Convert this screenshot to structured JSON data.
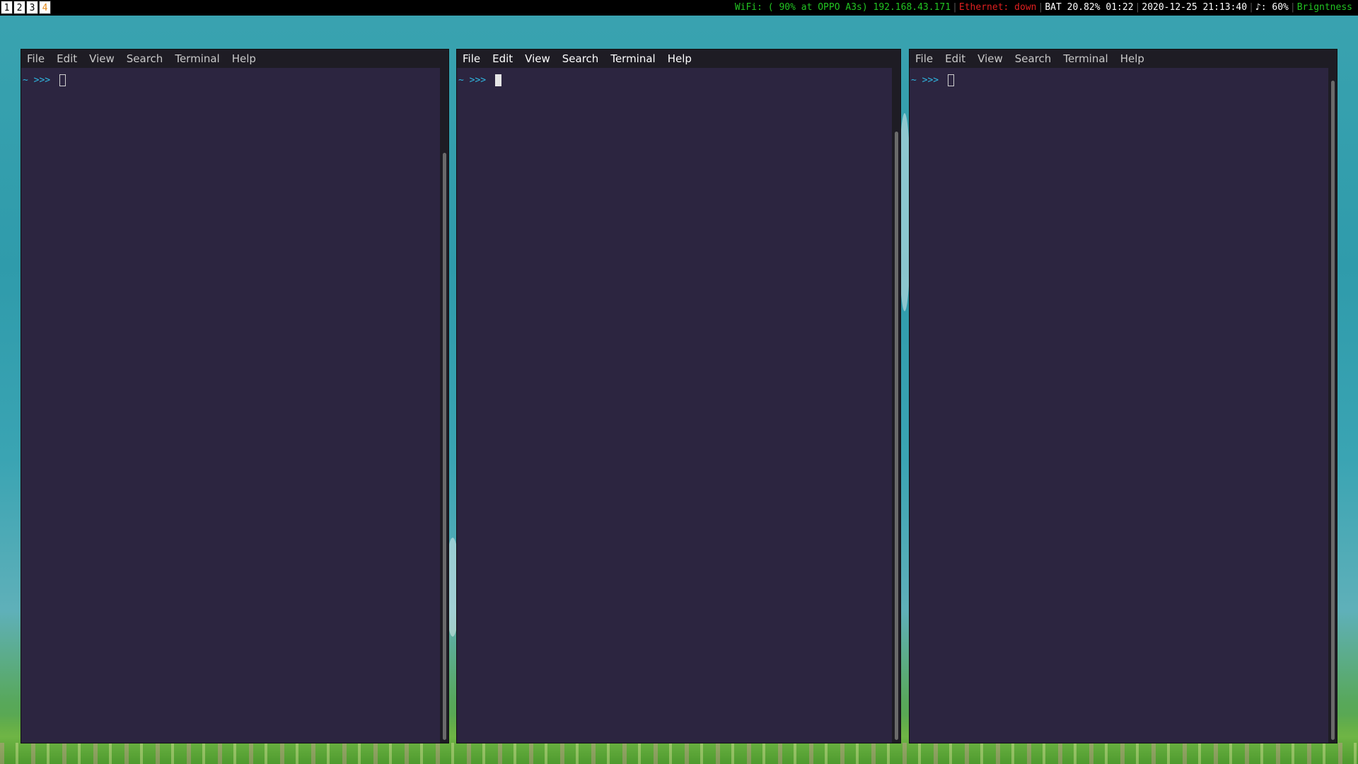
{
  "workspaces": [
    "1",
    "2",
    "3",
    "4"
  ],
  "active_workspace": "4",
  "status": {
    "wifi": "WiFi: ( 90% at OPPO A3s) 192.168.43.171",
    "ethernet": "Ethernet: down",
    "battery": "BAT 20.82% 01:22",
    "datetime": "2020-12-25 21:13:40",
    "volume": "♪: 60%",
    "brightness": "Brigntness"
  },
  "colors": {
    "wifi": "#22c422",
    "ethernet": "#e02020",
    "neutral": "#ffffff",
    "brightness": "#22c422",
    "prompt": "#2fb6e0",
    "terminal_bg": "#2c2540"
  },
  "terminals": [
    {
      "menu": [
        "File",
        "Edit",
        "View",
        "Search",
        "Terminal",
        "Help"
      ],
      "prompt": "~ >>> ",
      "focused": false
    },
    {
      "menu": [
        "File",
        "Edit",
        "View",
        "Search",
        "Terminal",
        "Help"
      ],
      "prompt": "~ >>> ",
      "focused": true
    },
    {
      "menu": [
        "File",
        "Edit",
        "View",
        "Search",
        "Terminal",
        "Help"
      ],
      "prompt": "~ >>> ",
      "focused": false
    }
  ]
}
